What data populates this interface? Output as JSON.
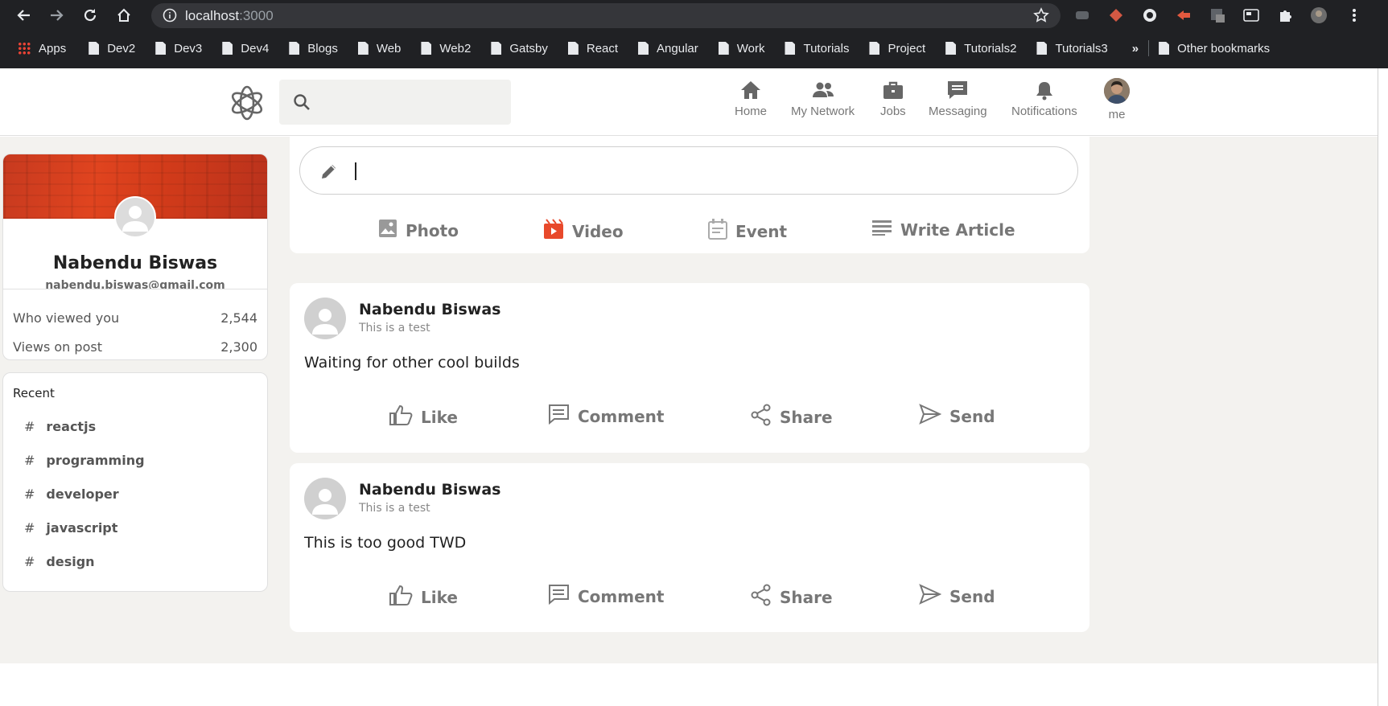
{
  "browser": {
    "url_host": "localhost",
    "url_port": ":3000",
    "bookmarks": [
      {
        "label": "Apps",
        "type": "apps"
      },
      {
        "label": "Dev2",
        "type": "folder"
      },
      {
        "label": "Dev3",
        "type": "folder"
      },
      {
        "label": "Dev4",
        "type": "folder"
      },
      {
        "label": "Blogs",
        "type": "folder"
      },
      {
        "label": "Web",
        "type": "folder"
      },
      {
        "label": "Web2",
        "type": "folder"
      },
      {
        "label": "Gatsby",
        "type": "folder"
      },
      {
        "label": "React",
        "type": "folder"
      },
      {
        "label": "Angular",
        "type": "folder"
      },
      {
        "label": "Work",
        "type": "folder"
      },
      {
        "label": "Tutorials",
        "type": "folder"
      },
      {
        "label": "Project",
        "type": "folder"
      },
      {
        "label": "Tutorials2",
        "type": "folder"
      },
      {
        "label": "Tutorials3",
        "type": "folder"
      }
    ],
    "overflow": "»",
    "other_bookmarks": "Other bookmarks"
  },
  "header": {
    "search_placeholder": "",
    "nav": [
      {
        "label": "Home",
        "icon": "home-icon"
      },
      {
        "label": "My Network",
        "icon": "people-icon"
      },
      {
        "label": "Jobs",
        "icon": "briefcase-icon"
      },
      {
        "label": "Messaging",
        "icon": "chat-icon"
      },
      {
        "label": "Notifications",
        "icon": "bell-icon"
      },
      {
        "label": "me",
        "icon": "avatar"
      }
    ]
  },
  "sidebar": {
    "name": "Nabendu Biswas",
    "email": "nabendu.biswas@gmail.com",
    "stats": [
      {
        "label": "Who viewed you",
        "value": "2,544"
      },
      {
        "label": "Views on post",
        "value": "2,300"
      }
    ],
    "recent_title": "Recent",
    "recent_tags": [
      "reactjs",
      "programming",
      "developer",
      "javascript",
      "design"
    ],
    "hash": "#"
  },
  "composer": {
    "options": [
      {
        "label": "Photo",
        "color": "#888888"
      },
      {
        "label": "Video",
        "color": "#e8492b"
      },
      {
        "label": "Event",
        "color": "#aaaaaa"
      },
      {
        "label": "Write Article",
        "color": "#888888"
      }
    ]
  },
  "posts": [
    {
      "name": "Nabendu Biswas",
      "description": "This is a test",
      "message": "Waiting for other cool builds"
    },
    {
      "name": "Nabendu Biswas",
      "description": "This is a test",
      "message": "This is too good TWD"
    }
  ],
  "post_actions": [
    "Like",
    "Comment",
    "Share",
    "Send"
  ]
}
